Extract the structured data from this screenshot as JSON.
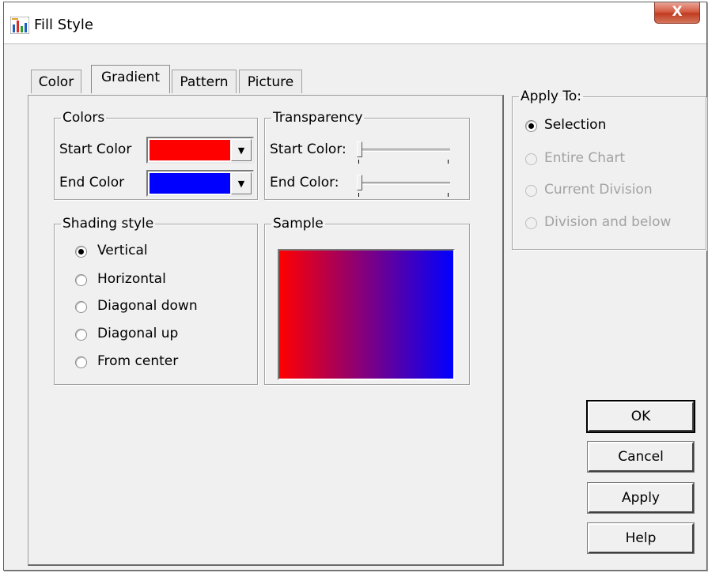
{
  "window": {
    "title": "Fill Style",
    "close_glyph": "X"
  },
  "tabs": [
    {
      "label": "Color",
      "active": false
    },
    {
      "label": "Gradient",
      "active": true
    },
    {
      "label": "Pattern",
      "active": false
    },
    {
      "label": "Picture",
      "active": false
    }
  ],
  "colors_group": {
    "legend": "Colors",
    "start_label": "Start Color",
    "end_label": "End Color",
    "start_color": "#ff0000",
    "end_color": "#0000ff"
  },
  "transparency_group": {
    "legend": "Transparency",
    "start_label": "Start Color:",
    "end_label": "End Color:",
    "start_value": 0,
    "end_value": 0
  },
  "shading_group": {
    "legend": "Shading style",
    "options": [
      {
        "label": "Vertical",
        "checked": true
      },
      {
        "label": "Horizontal",
        "checked": false
      },
      {
        "label": "Diagonal down",
        "checked": false
      },
      {
        "label": "Diagonal up",
        "checked": false
      },
      {
        "label": "From center",
        "checked": false
      }
    ]
  },
  "sample_group": {
    "legend": "Sample",
    "from_color": "#ff0000",
    "to_color": "#0000ff"
  },
  "apply_to_group": {
    "legend": "Apply To:",
    "options": [
      {
        "label": "Selection",
        "checked": true,
        "enabled": true
      },
      {
        "label": "Entire Chart",
        "checked": false,
        "enabled": false
      },
      {
        "label": "Current Division",
        "checked": false,
        "enabled": false
      },
      {
        "label": "Division and below",
        "checked": false,
        "enabled": false
      }
    ]
  },
  "buttons": {
    "ok": "OK",
    "cancel": "Cancel",
    "apply": "Apply",
    "help": "Help"
  },
  "icons": {
    "app": "chart-icon",
    "close": "close-icon",
    "dropdown": "dropdown-arrow-icon"
  }
}
